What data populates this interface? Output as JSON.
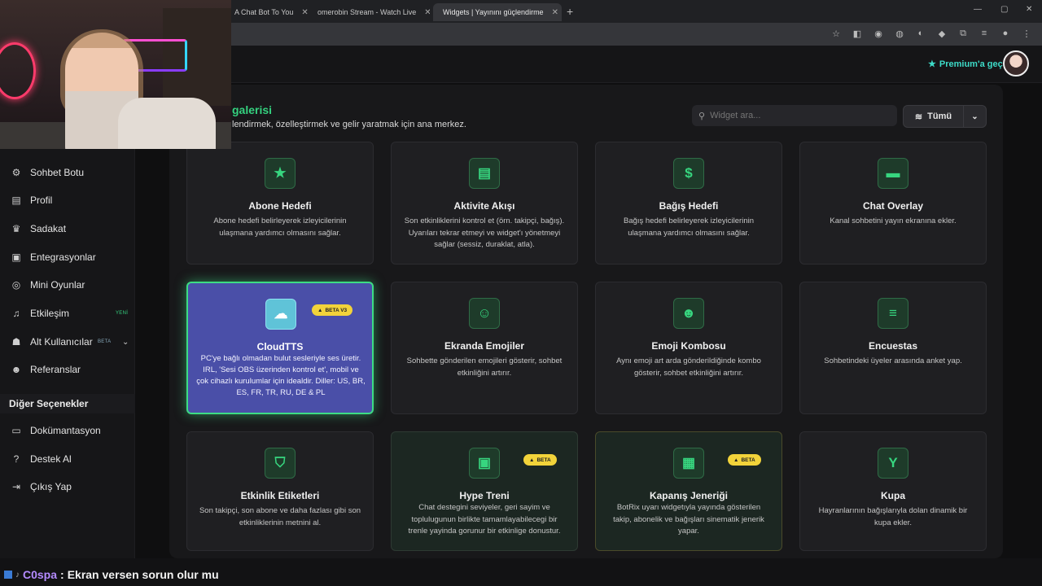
{
  "browser": {
    "tabs": [
      {
        "title": "A Chat Bot To You"
      },
      {
        "title": "omerobin Stream - Watch Live"
      },
      {
        "title": "Widgets | Yayınını güçlendirme"
      }
    ],
    "new_tab": "+",
    "window_controls": [
      "—",
      "▢",
      "✕"
    ]
  },
  "header": {
    "premium_label": "Premium'a geç"
  },
  "sidebar": {
    "items": [
      {
        "label": "Sohbet Botu",
        "icon": "robot-icon"
      },
      {
        "label": "Profil",
        "icon": "id-card-icon"
      },
      {
        "label": "Sadakat",
        "icon": "trophy-icon"
      },
      {
        "label": "Entegrasyonlar",
        "icon": "integrations-icon"
      },
      {
        "label": "Mini Oyunlar",
        "icon": "gamepad-icon"
      },
      {
        "label": "Etkileşim",
        "icon": "music-icon",
        "badge": "YENİ"
      },
      {
        "label": "Alt Kullanıcılar",
        "icon": "users-icon",
        "badge": "BETA"
      },
      {
        "label": "Referanslar",
        "icon": "referral-icon"
      }
    ],
    "section_heading": "Diğer Seçenekler",
    "other_items": [
      {
        "label": "Dokümantasyon",
        "icon": "book-icon"
      },
      {
        "label": "Destek Al",
        "icon": "help-icon"
      },
      {
        "label": "Çıkış Yap",
        "icon": "logout-icon"
      }
    ]
  },
  "main": {
    "title": "galerisi",
    "subtitle": "lendirmek, özelleştirmek ve gelir yaratmak için ana merkez.",
    "search_placeholder": "Widget ara...",
    "filter_label": "Tümü",
    "cards": [
      {
        "title": "Abone Hedefi",
        "desc": "Abone hedefi belirleyerek izleyicilerinin ulaşmana yardımcı olmasını sağlar.",
        "icon": "★"
      },
      {
        "title": "Aktivite Akışı",
        "desc": "Son etkinliklerini kontrol et (örn. takipçi, bağış). Uyarıları tekrar etmeyi ve widget'ı yönetmeyi sağlar (sessiz, duraklat, atla).",
        "icon": "▤"
      },
      {
        "title": "Bağış Hedefi",
        "desc": "Bağış hedefi belirleyerek izleyicilerinin ulaşmana yardımcı olmasını sağlar.",
        "icon": "$"
      },
      {
        "title": "Chat Overlay",
        "desc": "Kanal sohbetini yayın ekranına ekler.",
        "icon": "▬"
      },
      {
        "title": "CloudTTS",
        "desc": "PC'ye bağlı olmadan bulut sesleriyle ses üretir. IRL, 'Sesi OBS üzerinden kontrol et', mobil ve çok cihazlı kurulumlar için idealdir. Diller: US, BR, ES, FR, TR, RU, DE & PL",
        "icon": "☁",
        "badge": "BETA V3"
      },
      {
        "title": "Ekranda Emojiler",
        "desc": "Sohbette gönderilen emojileri gösterir, sohbet etkinliğini artırır.",
        "icon": "☺"
      },
      {
        "title": "Emoji Kombosu",
        "desc": "Aynı emoji art arda gönderildiğinde kombo gösterir, sohbet etkinliğini artırır.",
        "icon": "☻"
      },
      {
        "title": "Encuestas",
        "desc": "Sohbetindeki üyeler arasında anket yap.",
        "icon": "≡"
      },
      {
        "title": "Etkinlik Etiketleri",
        "desc": "Son takipçi, son abone ve daha fazlası gibi son etkinliklerinin metnini al.",
        "icon": "⛉"
      },
      {
        "title": "Hype Treni",
        "desc": "Chat destegini seviyeler, geri sayim ve toplulugunun birlikte tamamlayabilecegi bir trenle yayinda gorunur bir etkinlige donustur.",
        "icon": "▣",
        "badge": "BETA"
      },
      {
        "title": "Kapanış Jeneriği",
        "desc": "BotRix uyarı widgetıyla yayında gösterilen takip, abonelik ve bağışları sinematik jenerik yapar.",
        "icon": "▦",
        "badge": "BETA"
      },
      {
        "title": "Kupa",
        "desc": "Hayranlarının bağışlarıyla dolan dinamik bir kupa ekler.",
        "icon": "Y"
      }
    ]
  },
  "chat": {
    "user": "C0spa",
    "separator": ":",
    "message": "Ekran versen sorun olur mu"
  },
  "colors": {
    "accent": "#34d17f",
    "featured_bg": "#4a4fa8",
    "badge": "#f2d33a"
  }
}
